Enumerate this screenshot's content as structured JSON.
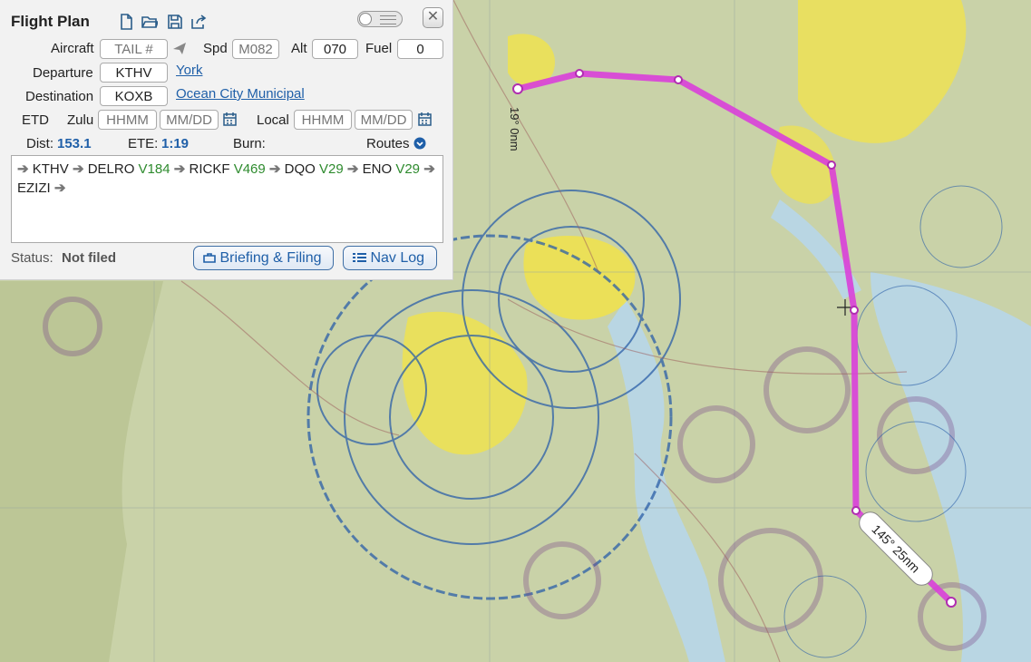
{
  "panel": {
    "title": "Flight Plan",
    "toolbar_icons": [
      "new-document-icon",
      "open-folder-icon",
      "save-icon",
      "share-icon"
    ],
    "aircraft": {
      "label": "Aircraft",
      "placeholder": "TAIL #",
      "icon": "airplane-icon"
    },
    "speed": {
      "label": "Spd",
      "placeholder": "M082"
    },
    "altitude": {
      "label": "Alt",
      "value": "070"
    },
    "fuel": {
      "label": "Fuel",
      "value": "0"
    },
    "departure": {
      "label": "Departure",
      "code": "KTHV",
      "name": "York"
    },
    "destination": {
      "label": "Destination",
      "code": "KOXB",
      "name": "Ocean City Municipal"
    },
    "etd": {
      "label": "ETD",
      "zulu_label": "Zulu",
      "zulu_time_placeholder": "HHMM",
      "zulu_date_placeholder": "MM/DD",
      "local_label": "Local",
      "local_time_placeholder": "HHMM",
      "local_date_placeholder": "MM/DD"
    },
    "dist": {
      "label": "Dist:",
      "value": "153.1"
    },
    "ete": {
      "label": "ETE:",
      "value": "1:19"
    },
    "burn": {
      "label": "Burn:"
    },
    "routes_label": "Routes",
    "route": [
      {
        "text": "KTHV",
        "kind": "waypoint"
      },
      {
        "text": "DELRO",
        "kind": "waypoint"
      },
      {
        "text": "V184",
        "kind": "airway"
      },
      {
        "text": "RICKF",
        "kind": "waypoint"
      },
      {
        "text": "V469",
        "kind": "airway"
      },
      {
        "text": "DQO",
        "kind": "waypoint"
      },
      {
        "text": "V29",
        "kind": "airway"
      },
      {
        "text": "ENO",
        "kind": "waypoint"
      },
      {
        "text": "V29",
        "kind": "airway"
      },
      {
        "text": "EZIZI",
        "kind": "waypoint"
      }
    ],
    "status": {
      "label": "Status:",
      "value": "Not filed"
    },
    "briefing_button": "Briefing & Filing",
    "navlog_button": "Nav Log"
  },
  "map": {
    "leg_label_1": "19° 0nm",
    "leg_label_2": "145° 25nm",
    "colors": {
      "route": "#d93fd9",
      "water": "#b9d6e3",
      "land": "#c9d2a8",
      "urban": "#f1e34a",
      "airspace": "#2b5fa8"
    }
  }
}
